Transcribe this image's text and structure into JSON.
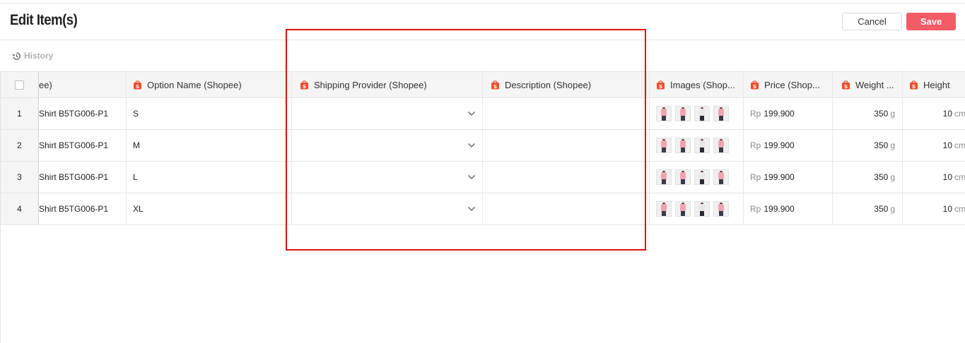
{
  "header": {
    "title": "Edit Item(s)",
    "cancel_label": "Cancel",
    "save_label": "Save"
  },
  "toolbar": {
    "history_label": "History"
  },
  "colors": {
    "save_button": "#f25c67",
    "shopee_orange": "#ee4d2d",
    "highlight_border": "#e01111"
  },
  "table": {
    "columns": {
      "name": "ee)",
      "option": "Option Name (Shopee)",
      "shipping": "Shipping Provider (Shopee)",
      "description": "Description (Shopee)",
      "images": "Images (Shop...",
      "price": "Price (Shop...",
      "weight": "Weight ...",
      "height": "Height"
    },
    "rows": [
      {
        "index": "1",
        "name": "Shirt B5TG006-P1",
        "option": "S",
        "shipping": "",
        "description": "",
        "price_currency": "Rp",
        "price": "199.900",
        "weight": "350",
        "weight_unit": "g",
        "height": "10",
        "height_unit": "cm"
      },
      {
        "index": "2",
        "name": "Shirt B5TG006-P1",
        "option": "M",
        "shipping": "",
        "description": "",
        "price_currency": "Rp",
        "price": "199.900",
        "weight": "350",
        "weight_unit": "g",
        "height": "10",
        "height_unit": "cm"
      },
      {
        "index": "3",
        "name": "Shirt B5TG006-P1",
        "option": "L",
        "shipping": "",
        "description": "",
        "price_currency": "Rp",
        "price": "199.900",
        "weight": "350",
        "weight_unit": "g",
        "height": "10",
        "height_unit": "cm"
      },
      {
        "index": "4",
        "name": "Shirt B5TG006-P1",
        "option": "XL",
        "shipping": "",
        "description": "",
        "price_currency": "Rp",
        "price": "199.900",
        "weight": "350",
        "weight_unit": "g",
        "height": "10",
        "height_unit": "cm"
      }
    ]
  }
}
